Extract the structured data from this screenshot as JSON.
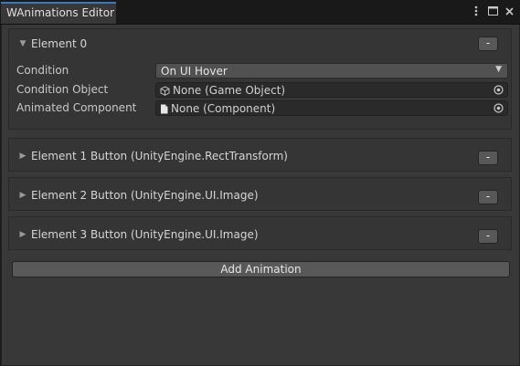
{
  "window": {
    "tab_title": "WAnimations Editor",
    "icons": [
      "more-vert-icon",
      "maximize-icon",
      "close-icon"
    ]
  },
  "elements": [
    {
      "label": "Element 0",
      "expanded": true,
      "remove_label": "-",
      "properties": {
        "condition_label": "Condition",
        "condition_value": "On UI Hover",
        "condition_object_label": "Condition Object",
        "condition_object_value": "None (Game Object)",
        "animated_component_label": "Animated Component",
        "animated_component_value": "None (Component)"
      }
    },
    {
      "label": "Element 1 Button (UnityEngine.RectTransform)",
      "expanded": false,
      "remove_label": "-"
    },
    {
      "label": "Element 2 Button (UnityEngine.UI.Image)",
      "expanded": false,
      "remove_label": "-"
    },
    {
      "label": "Element 3 Button (UnityEngine.UI.Image)",
      "expanded": false,
      "remove_label": "-"
    }
  ],
  "add_button_label": "Add Animation",
  "colors": {
    "tab_accent": "#3a79bb",
    "panel_bg": "#383838",
    "button_bg": "#585858"
  }
}
